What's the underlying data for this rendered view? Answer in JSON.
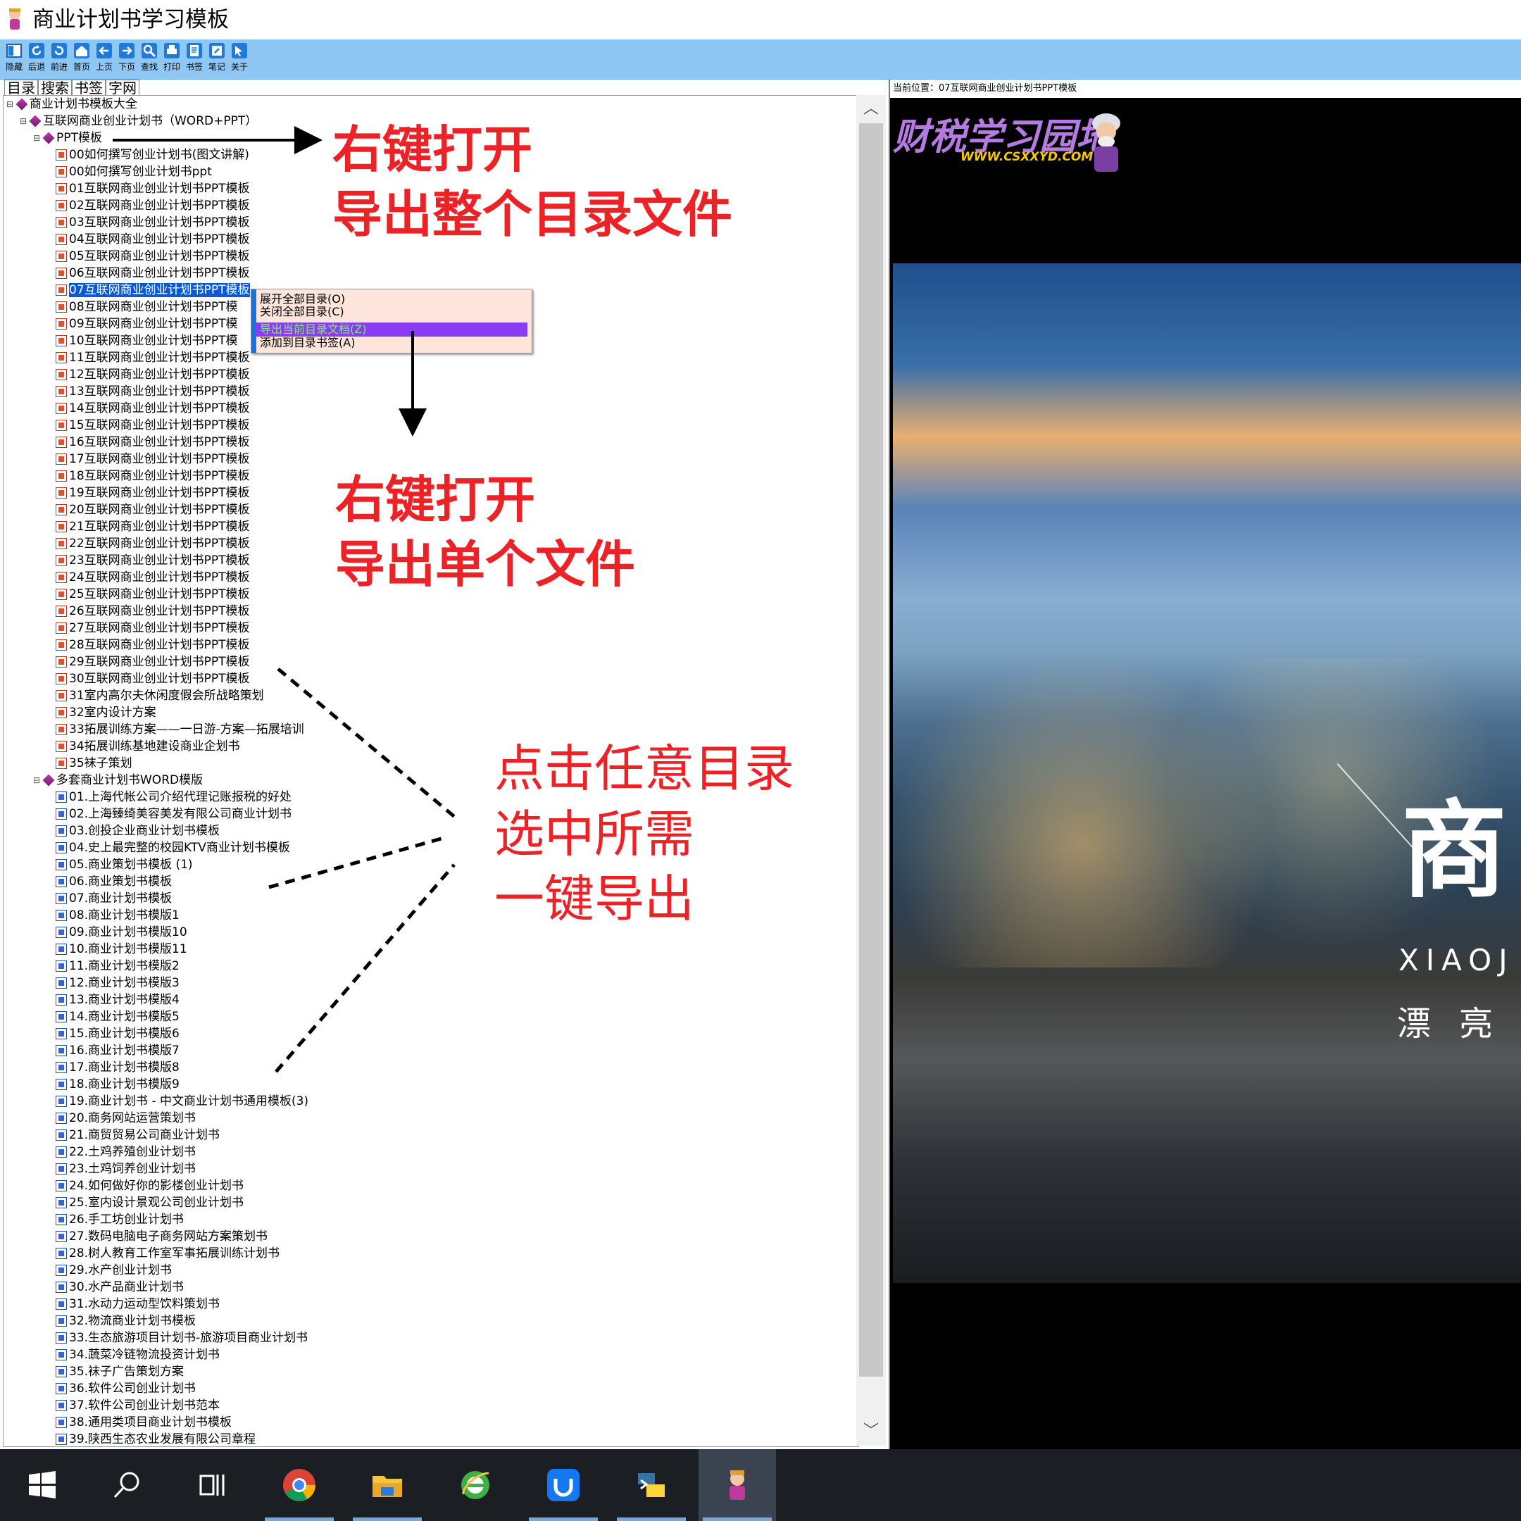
{
  "window": {
    "title": "商业计划书学习模板"
  },
  "toolbar": {
    "buttons": [
      {
        "label": "隐藏",
        "icon": "hide-icon"
      },
      {
        "label": "后退",
        "icon": "back-icon"
      },
      {
        "label": "前进",
        "icon": "forward-icon"
      },
      {
        "label": "首页",
        "icon": "home-icon"
      },
      {
        "label": "上页",
        "icon": "prev-page-icon"
      },
      {
        "label": "下页",
        "icon": "next-page-icon"
      },
      {
        "label": "查找",
        "icon": "search-icon"
      },
      {
        "label": "打印",
        "icon": "print-icon"
      },
      {
        "label": "书签",
        "icon": "bookmark-icon"
      },
      {
        "label": "笔记",
        "icon": "notes-icon"
      },
      {
        "label": "关于",
        "icon": "about-icon"
      }
    ]
  },
  "left_tabs": [
    "目录",
    "搜索",
    "书签",
    "字网"
  ],
  "tree": {
    "root": "商业计划书模板大全",
    "book1": "互联网商业创业计划书（WORD+PPT）",
    "folder1": "PPT模板",
    "folder1_items": [
      "00如何撰写创业计划书(图文讲解)",
      "00如何撰写创业计划书ppt",
      "01互联网商业创业计划书PPT模板",
      "02互联网商业创业计划书PPT模板",
      "03互联网商业创业计划书PPT模板",
      "04互联网商业创业计划书PPT模板",
      "05互联网商业创业计划书PPT模板",
      "06互联网商业创业计划书PPT模板",
      "07互联网商业创业计划书PPT模板",
      "08互联网商业创业计划书PPT模",
      "09互联网商业创业计划书PPT模",
      "10互联网商业创业计划书PPT模",
      "11互联网商业创业计划书PPT模板",
      "12互联网商业创业计划书PPT模板",
      "13互联网商业创业计划书PPT模板",
      "14互联网商业创业计划书PPT模板",
      "15互联网商业创业计划书PPT模板",
      "16互联网商业创业计划书PPT模板",
      "17互联网商业创业计划书PPT模板",
      "18互联网商业创业计划书PPT模板",
      "19互联网商业创业计划书PPT模板",
      "20互联网商业创业计划书PPT模板",
      "21互联网商业创业计划书PPT模板",
      "22互联网商业创业计划书PPT模板",
      "23互联网商业创业计划书PPT模板",
      "24互联网商业创业计划书PPT模板",
      "25互联网商业创业计划书PPT模板",
      "26互联网商业创业计划书PPT模板",
      "27互联网商业创业计划书PPT模板",
      "28互联网商业创业计划书PPT模板",
      "29互联网商业创业计划书PPT模板",
      "30互联网商业创业计划书PPT模板",
      "31室内高尔夫休闲度假会所战略策划",
      "32室内设计方案",
      "33拓展训练方案——一日游-方案—拓展培训",
      "34拓展训练基地建设商业企划书",
      "35袜子策划"
    ],
    "folder2": "多套商业计划书WORD模版",
    "folder2_items": [
      "01.上海代帐公司介绍代理记账报税的好处",
      "02.上海臻绮美容美发有限公司商业计划书",
      "03.创投企业商业计划书模板",
      "04.史上最完整的校园KTV商业计划书模板",
      "05.商业策划书模板 (1)",
      "06.商业策划书模板",
      "07.商业计划书模板",
      "08.商业计划书模版1",
      "09.商业计划书模版10",
      "10.商业计划书模版11",
      "11.商业计划书模版2",
      "12.商业计划书模版3",
      "13.商业计划书模版4",
      "14.商业计划书模版5",
      "15.商业计划书模版6",
      "16.商业计划书模版7",
      "17.商业计划书模版8",
      "18.商业计划书模版9",
      "19.商业计划书 - 中文商业计划书通用模板(3)",
      "20.商务网站运营策划书",
      "21.商贸贸易公司商业计划书",
      "22.土鸡养殖创业计划书",
      "23.土鸡饲养创业计划书",
      "24.如何做好你的影楼创业计划书",
      "25.室内设计景观公司创业计划书",
      "26.手工坊创业计划书",
      "27.数码电脑电子商务网站方案策划书",
      "28.树人教育工作室军事拓展训练计划书",
      "29.水产创业计划书",
      "30.水产品商业计划书",
      "31.水动力运动型饮料策划书",
      "32.物流商业计划书模板",
      "33.生态旅游项目计划书-旅游项目商业计划书",
      "34.蔬菜冷链物流投资计划书",
      "35.袜子广告策划方案",
      "36.软件公司创业计划书",
      "37.软件公司创业计划书范本",
      "38.通用类项目商业计划书模板",
      "39.陕西生态农业发展有限公司章程"
    ]
  },
  "context_menu": {
    "items": [
      "展开全部目录(O)",
      "关闭全部目录(C)",
      "导出当前目录文档(Z)",
      "添加到目录书签(A)"
    ]
  },
  "annotations": {
    "a1_line1": "右键打开",
    "a1_line2": "导出整个目录文件",
    "a2_line1": "右键打开",
    "a2_line2": "导出单个文件",
    "a3_line1": "点击任意目录",
    "a3_line2": "选中所需",
    "a3_line3": "一键导出"
  },
  "viewer": {
    "location_label": "当前位置：",
    "location_value": "07互联网商业创业计划书PPT模板",
    "logo_text": "财税学习园地",
    "logo_url": "WWW.CSXXYD.COM",
    "slide_title": "商",
    "slide_subtitle": "XIAOJ",
    "slide_subtitle2": "漂亮"
  },
  "taskbar": {
    "items": [
      "windows-start-icon",
      "search-icon",
      "task-view-icon",
      "chrome-icon",
      "file-explorer-icon",
      "ie-browser-icon",
      "baidu-netdisk-icon",
      "python-icon",
      "app-mascot-icon"
    ]
  },
  "colors": {
    "annotation_red": "#ec2227",
    "toolbar_blue": "#8fc7f4",
    "selection_blue": "#0a5ad6",
    "menu_highlight": "#8b3cf0"
  }
}
